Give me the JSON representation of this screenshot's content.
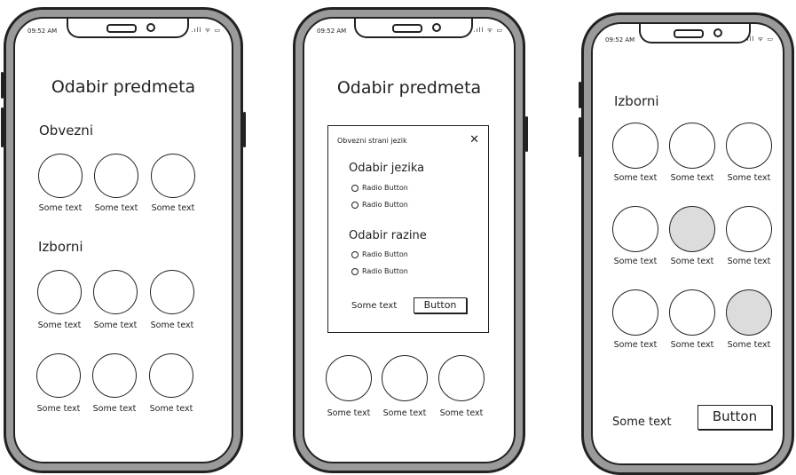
{
  "screens": [
    {
      "status_time": "09:52 AM",
      "status_icons": ".ıll ᯤ ▭",
      "title": "Odabir predmeta",
      "section1": "Obvezni",
      "section2": "Izborni",
      "labels": [
        "Some text",
        "Some text",
        "Some text",
        "Some text",
        "Some text",
        "Some text",
        "Some text",
        "Some text",
        "Some text"
      ]
    },
    {
      "status_time": "09:52 AM",
      "status_icons": ".ıll ᯤ ▭",
      "title": "Odabir predmeta",
      "dialog": {
        "title": "Obvezni strani jezik",
        "close": "✕",
        "group1": "Odabir jezika",
        "group1_options": [
          "Radio Button",
          "Radio Button"
        ],
        "group2": "Odabir razine",
        "group2_options": [
          "Radio Button",
          "Radio Button"
        ],
        "footer_text": "Some text",
        "button": "Button"
      },
      "labels": [
        "Some text",
        "Some text",
        "Some text"
      ]
    },
    {
      "status_time": "09:52 AM",
      "status_icons": ".ıll ᯤ ▭",
      "section": "Izborni",
      "labels": [
        "Some text",
        "Some text",
        "Some text",
        "Some text",
        "Some text",
        "Some text",
        "Some text",
        "Some text",
        "Some text"
      ],
      "selected": [
        4,
        8
      ],
      "footer_text": "Some text",
      "button": "Button"
    }
  ]
}
